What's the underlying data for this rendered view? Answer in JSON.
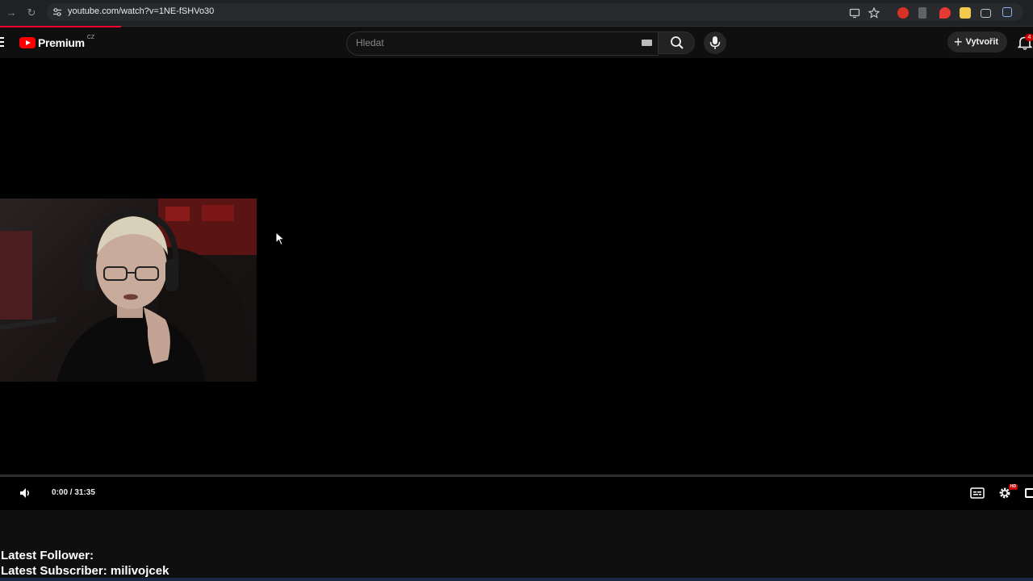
{
  "browser": {
    "url": "youtube.com/watch?v=1NE-fSHVo30"
  },
  "header": {
    "logo_text": "Premium",
    "logo_region": "CZ",
    "search_placeholder": "Hledat",
    "create_label": "Vytvořit",
    "notification_count": "4"
  },
  "player": {
    "time_display": "0:00 / 31:35",
    "progress": 0,
    "quality_badge": "HD"
  },
  "overlay": {
    "follower_line": "Latest Follower:",
    "subscriber_line": "Latest Subscriber: milivojcek"
  },
  "colors": {
    "brand_red": "#ff0000",
    "page_bg": "#0f0f0f",
    "player_bg": "#000000",
    "accent_red": "#ff0033"
  }
}
